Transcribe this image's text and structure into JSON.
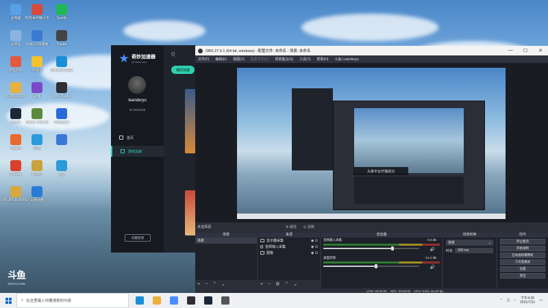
{
  "desktop": {
    "icons": [
      {
        "label": "此电脑",
        "color": "#5aa0e6"
      },
      {
        "label": "吃鸡世界精灵平台",
        "color": "#d94a3a"
      },
      {
        "label": "Spotify",
        "color": "#1db954"
      },
      {
        "label": "回收站",
        "color": "#8ab4e0"
      },
      {
        "label": "网易UU加速器",
        "color": "#3a7bd5"
      },
      {
        "label": "Squad",
        "color": "#444"
      },
      {
        "label": "玩机助手",
        "color": "#e35b3c"
      },
      {
        "label": "YY语音",
        "color": "#f3c22c"
      },
      {
        "label": "Microsoft Edge",
        "color": "#1a8fd8"
      },
      {
        "label": "STANDARD",
        "color": "#e8b13c"
      },
      {
        "label": "战魂",
        "color": "#7a4ac9"
      },
      {
        "label": "OBS Studio",
        "color": "#302e31"
      },
      {
        "label": "steam",
        "color": "#1b2838"
      },
      {
        "label": "Grand Theft Auto V",
        "color": "#5a8a3c"
      },
      {
        "label": "Wallpaper",
        "color": "#2a6ad8"
      },
      {
        "label": "FinalM",
        "color": "#e86a2c"
      },
      {
        "label": "迅游",
        "color": "#2a9ad8"
      },
      {
        "label": "",
        "color": "#3a78d8"
      },
      {
        "label": "Garena",
        "color": "#d8402c"
      },
      {
        "label": "PUBG",
        "color": "#c8a23c"
      },
      {
        "label": "QQ",
        "color": "#2a9ad8"
      },
      {
        "label": "PLAYERUNKNOWN'S BATTLEG...",
        "color": "#d8a83c"
      },
      {
        "label": "百度网盘",
        "color": "#2a7ad8"
      }
    ]
  },
  "qimiao": {
    "logo_title": "奇妙加速器",
    "logo_sub": "Qi Miao.com",
    "username": "leanderyu",
    "user_id": "ID:4218159",
    "nav": [
      {
        "label": "首页",
        "icon": "home-icon"
      },
      {
        "label": "游戏加速",
        "icon": "gamepad-icon"
      }
    ],
    "my_accel_tab": "我的加速",
    "feedback": "问题反馈",
    "search_glyph": "Q"
  },
  "obs": {
    "title": "OBS 27.0.1 (64-bit, windows) - 配置文件: 未命名 - 场景: 未命名",
    "window_controls": [
      "—",
      "☐",
      "✕"
    ],
    "menu": [
      "文件(F)",
      "编辑(E)",
      "视图(V)",
      "配置文件(P)",
      "场景集合(S)",
      "工具(T)",
      "帮助(H)",
      "斗鱼-Leanderyu"
    ],
    "menu_dim_index": 3,
    "preview_toast": "头像平台开播成功",
    "no_source_selected": "未选择源",
    "props_button": "属性",
    "filters_button": "滤镜",
    "docks": {
      "scenes": {
        "title": "场景",
        "items": [
          "场景"
        ]
      },
      "sources": {
        "title": "来源",
        "items": [
          {
            "label": "显示器采集",
            "icon": "monitor-icon"
          },
          {
            "label": "音频输入采集",
            "icon": "mic-icon"
          },
          {
            "label": "图像",
            "icon": "image-icon"
          }
        ]
      },
      "mixer": {
        "title": "混音器",
        "tracks": [
          {
            "label": "音频输入采集",
            "db": "0.0 dB",
            "level": 0.72
          },
          {
            "label": "桌面音频",
            "db": "-14.4 dB",
            "level": 0.55
          }
        ]
      },
      "transitions": {
        "title": "场景转换",
        "type": "渐变",
        "duration_label": "时长",
        "duration": "300 ms"
      },
      "controls": {
        "title": "控件",
        "buttons": [
          "停止推流",
          "开始录制",
          "启动虚拟摄像机",
          "工作室模式",
          "设置",
          "退出"
        ]
      }
    },
    "status": {
      "live": "LIVE: 00:00:00",
      "rec": "REC: 00:00:00",
      "cpu": "CPU: 6.0%, 60.00 fps"
    }
  },
  "watermark": {
    "logo": "斗鱼",
    "url": "DOUYU.COM"
  },
  "taskbar": {
    "search_placeholder": "在这里输入你要搜索的内容",
    "apps": [
      {
        "name": "edge-icon",
        "color": "#1a8fd8"
      },
      {
        "name": "explorer-icon",
        "color": "#e8b13c"
      },
      {
        "name": "qimiao-icon",
        "color": "#4a8dff"
      },
      {
        "name": "obs-icon",
        "color": "#302e31"
      },
      {
        "name": "steam-icon",
        "color": "#1b2838"
      },
      {
        "name": "game-icon",
        "color": "#555"
      }
    ],
    "time": "下午4:35",
    "date": "2021/7/21"
  },
  "colors": {
    "accent": "#2fd0b0",
    "obs_bg": "#2b2e38"
  }
}
